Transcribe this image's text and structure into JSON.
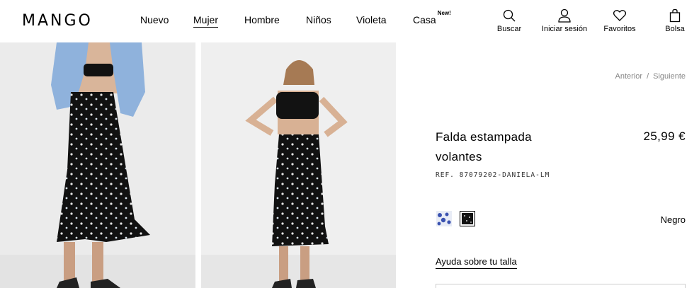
{
  "brand": {
    "logo": "MANGO"
  },
  "nav": {
    "items": [
      {
        "label": "Nuevo"
      },
      {
        "label": "Mujer"
      },
      {
        "label": "Hombre"
      },
      {
        "label": "Niños"
      },
      {
        "label": "Violeta"
      },
      {
        "label": "Casa",
        "badge": "New!"
      }
    ],
    "active": "Mujer"
  },
  "tools": {
    "search": "Buscar",
    "login": "Iniciar sesión",
    "favorites": "Favoritos",
    "bag": "Bolsa"
  },
  "pager": {
    "prev": "Anterior",
    "separator": "/",
    "next": "Siguiente"
  },
  "product": {
    "title": "Falda estampada volantes",
    "price": "25,99 €",
    "ref": "REF. 87079202-DANIELA-LM",
    "selected_color": "Negro",
    "swatches": [
      {
        "name": "blue-print",
        "color": "#3a52b0"
      },
      {
        "name": "black-print",
        "color": "#111111"
      }
    ],
    "size_help": "Ayuda sobre tu talla"
  }
}
